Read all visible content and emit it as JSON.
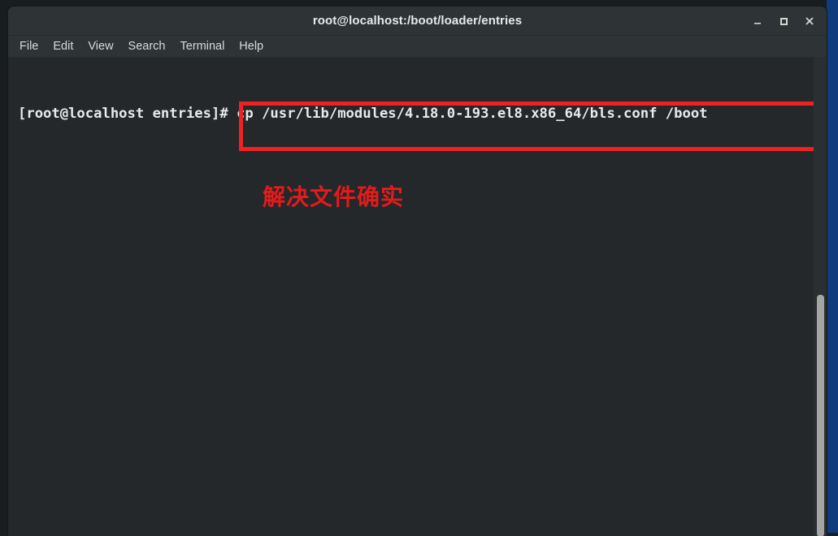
{
  "window": {
    "title": "root@localhost:/boot/loader/entries",
    "controls": [
      {
        "name": "minimize",
        "label": "Minimize"
      },
      {
        "name": "maximize",
        "label": "Maximize"
      },
      {
        "name": "close",
        "label": "Close"
      }
    ]
  },
  "menubar": {
    "items": [
      {
        "label": "File"
      },
      {
        "label": "Edit"
      },
      {
        "label": "View"
      },
      {
        "label": "Search"
      },
      {
        "label": "Terminal"
      },
      {
        "label": "Help"
      }
    ]
  },
  "terminal": {
    "prompt": "[root@localhost entries]#",
    "command": " cp /usr/lib/modules/4.18.0-193.el8.x86_64/bls.conf /boot",
    "full_line": "[root@localhost entries]# cp /usr/lib/modules/4.18.0-193.el8.x86_64/bls.conf /boot",
    "background_color": "#24282b",
    "text_color": "#e9e9e9"
  },
  "annotations": {
    "highlight_box_color": "#ee2222",
    "note_text": "解决文件确实",
    "note_color": "#e31b1b"
  },
  "scrollbar": {
    "thumb_color": "#a3a6a3",
    "track_color": "#2b2f32"
  },
  "desktop": {
    "accent_color": "#0e3c7d"
  }
}
